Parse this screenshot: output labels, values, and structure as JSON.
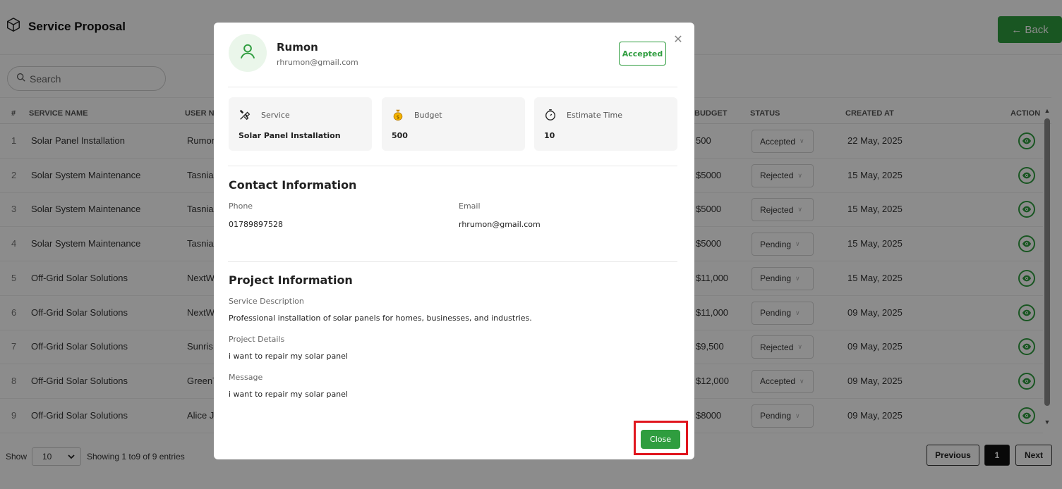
{
  "page": {
    "title": "Service Proposal",
    "back_label": "← Back",
    "search_placeholder": "Search"
  },
  "table": {
    "headers": {
      "num": "#",
      "service_name": "SERVICE NAME",
      "user_name": "USER NA",
      "budget": "BUDGET",
      "status": "STATUS",
      "created_at": "CREATED AT",
      "action": "ACTION"
    },
    "rows": [
      {
        "num": "1",
        "service": "Solar Panel Installation",
        "user": "Rumon",
        "budget": "500",
        "status": "Accepted",
        "created": "22 May, 2025"
      },
      {
        "num": "2",
        "service": "Solar System Maintenance",
        "user": "Tasnia",
        "budget": "$5000",
        "status": "Rejected",
        "created": "15 May, 2025"
      },
      {
        "num": "3",
        "service": "Solar System Maintenance",
        "user": "Tasnia",
        "budget": "$5000",
        "status": "Rejected",
        "created": "15 May, 2025"
      },
      {
        "num": "4",
        "service": "Solar System Maintenance",
        "user": "Tasnia",
        "budget": "$5000",
        "status": "Pending",
        "created": "15 May, 2025"
      },
      {
        "num": "5",
        "service": "Off-Grid Solar Solutions",
        "user": "NextW",
        "budget": "$11,000",
        "status": "Pending",
        "created": "15 May, 2025"
      },
      {
        "num": "6",
        "service": "Off-Grid Solar Solutions",
        "user": "NextW",
        "budget": "$11,000",
        "status": "Pending",
        "created": "09 May, 2025"
      },
      {
        "num": "7",
        "service": "Off-Grid Solar Solutions",
        "user": "Sunris",
        "budget": "$9,500",
        "status": "Rejected",
        "created": "09 May, 2025"
      },
      {
        "num": "8",
        "service": "Off-Grid Solar Solutions",
        "user": "GreenT",
        "budget": "$12,000",
        "status": "Accepted",
        "created": "09 May, 2025"
      },
      {
        "num": "9",
        "service": "Off-Grid Solar Solutions",
        "user": "Alice J",
        "budget": "$8000",
        "status": "Pending",
        "created": "09 May, 2025"
      }
    ]
  },
  "footer": {
    "show_label": "Show",
    "page_size": "10",
    "entries_text": "Showing 1  to9  of 9 entries",
    "prev_label": "Previous",
    "current_page": "1",
    "next_label": "Next"
  },
  "modal": {
    "user_name": "Rumon",
    "user_email": "rhrumon@gmail.com",
    "status_badge": "Accepted",
    "cards": {
      "service_label": "Service",
      "service_value": "Solar Panel Installation",
      "budget_label": "Budget",
      "budget_value": "500",
      "time_label": "Estimate Time",
      "time_value": "10"
    },
    "contact": {
      "title": "Contact Information",
      "phone_label": "Phone",
      "phone_value": "01789897528",
      "email_label": "Email",
      "email_value": "rhrumon@gmail.com"
    },
    "project": {
      "title": "Project Information",
      "desc_label": "Service Description",
      "desc_value": "Professional installation of solar panels for homes, businesses, and industries.",
      "details_label": "Project Details",
      "details_value": "i want to repair my solar panel",
      "message_label": "Message",
      "message_value": "i want to repair my solar panel"
    },
    "close_label": "Close"
  },
  "colors": {
    "brand_green": "#2f9d3f",
    "highlight_red": "#e0161e",
    "overlay": "rgba(0,0,0,0.45)"
  },
  "icons": {
    "title": "box-icon",
    "search": "search-icon",
    "view": "eye-icon",
    "avatar": "user-icon",
    "service": "tools-icon",
    "budget": "money-bag-icon",
    "time": "stopwatch-icon",
    "close": "close-icon"
  }
}
